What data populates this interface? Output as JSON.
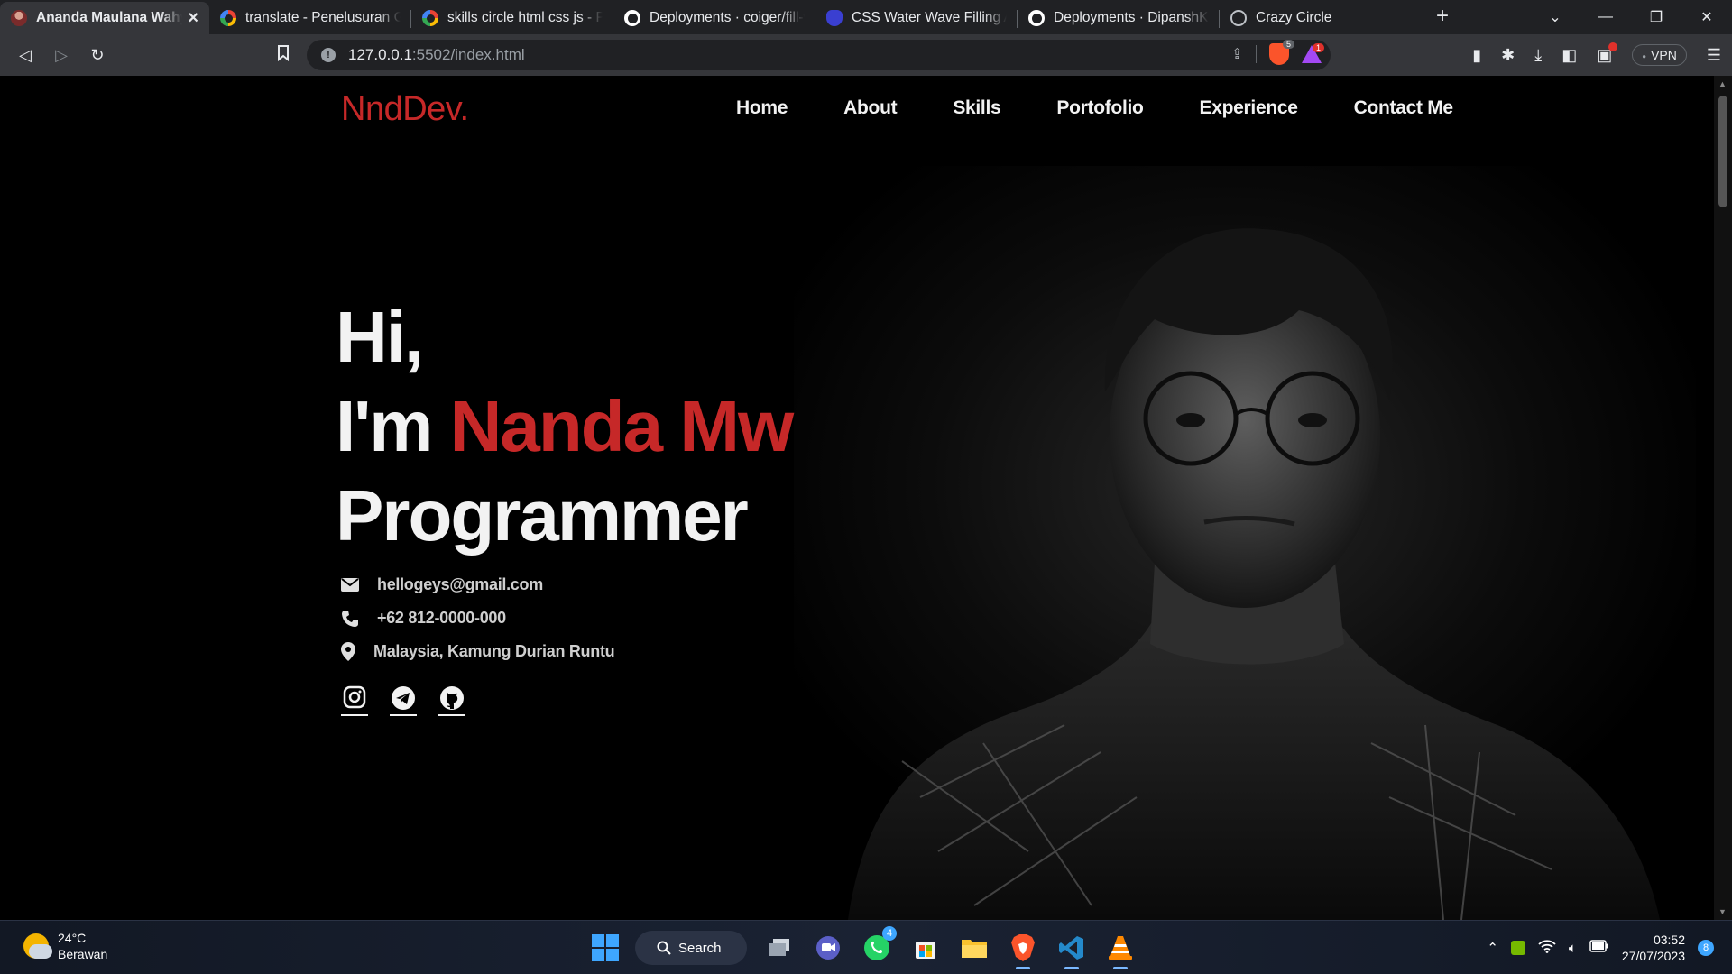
{
  "browser": {
    "tabs": [
      {
        "title": "Ananda Maulana Wahyudi",
        "favicon": "photo-favicon",
        "active": true
      },
      {
        "title": "translate - Penelusuran Google",
        "favicon": "google-favicon"
      },
      {
        "title": "skills circle html css js - Pen",
        "favicon": "google-favicon"
      },
      {
        "title": "Deployments · coiger/fill-water",
        "favicon": "github-favicon"
      },
      {
        "title": "CSS Water Wave Filling Animation",
        "favicon": "codepen-favicon"
      },
      {
        "title": "Deployments · DipanshKhandelwal",
        "favicon": "github-favicon"
      },
      {
        "title": "Crazy Circle",
        "favicon": "globe-favicon"
      }
    ],
    "url_host": "127.0.0.1",
    "url_rest": ":5502/index.html",
    "shield_count": "5",
    "rewards_count": "1",
    "vpn_label": "VPN"
  },
  "site": {
    "brand": "NndDev.",
    "nav": [
      "Home",
      "About",
      "Skills",
      "Portofolio",
      "Experience",
      "Contact Me"
    ],
    "hero": {
      "line1": "Hi,",
      "line2_prefix": "I'm ",
      "name": "Nanda Mw",
      "line3": "Programmer"
    },
    "contacts": {
      "email": "hellogeys@gmail.com",
      "phone": "+62 812-0000-000",
      "location": "Malaysia, Kamung Durian Runtu"
    },
    "socials": [
      "instagram-icon",
      "telegram-icon",
      "github-icon"
    ],
    "accent_color": "#c62828"
  },
  "taskbar": {
    "weather_temp": "24°C",
    "weather_desc": "Berawan",
    "search_label": "Search",
    "whatsapp_badge": "4",
    "time": "03:52",
    "date": "27/07/2023",
    "notifications": "8"
  }
}
